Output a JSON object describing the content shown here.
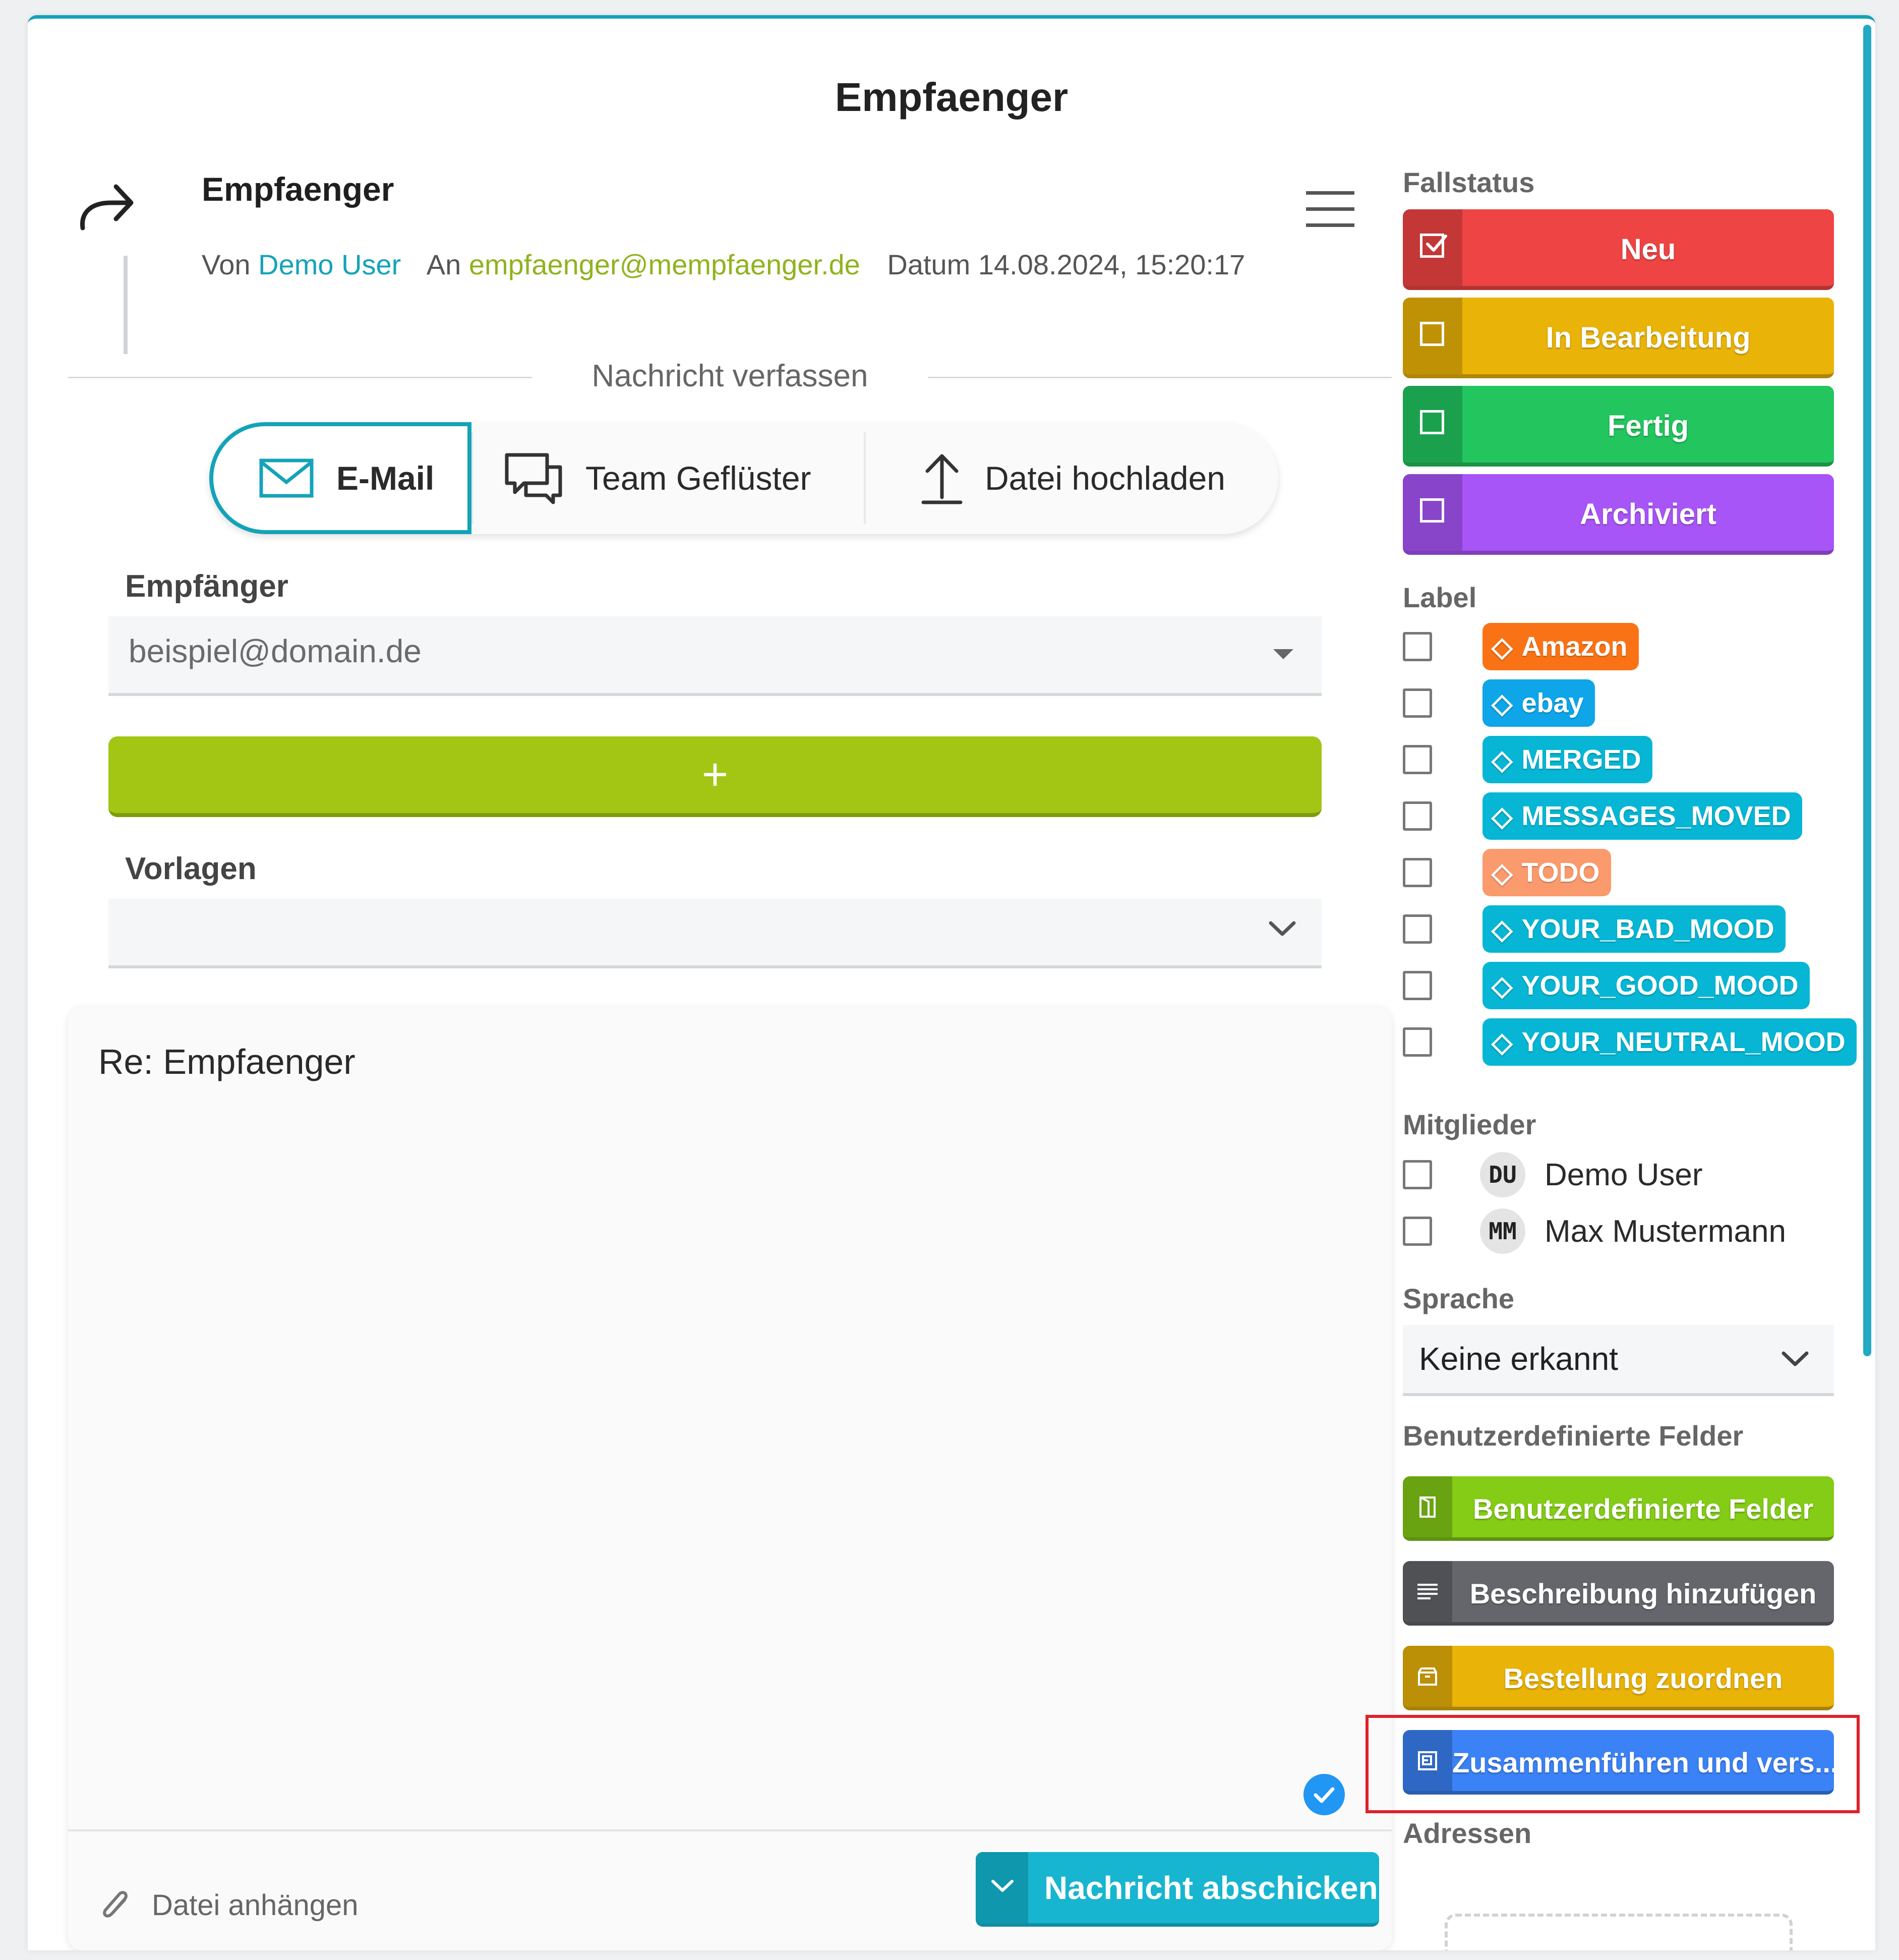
{
  "modal": {
    "title": "Empfaenger"
  },
  "message": {
    "subject": "Empfaenger",
    "from_label": "Von",
    "from_name": "Demo User",
    "to_label": "An",
    "to_address": "empfaenger@mempfaenger.de",
    "date_label": "Datum",
    "date_value": "14.08.2024, 15:20:17"
  },
  "compose": {
    "divider": "Nachricht verfassen",
    "tabs": [
      {
        "label": "E-Mail",
        "icon": "envelope-icon",
        "active": true
      },
      {
        "label": "Team Geflüster",
        "icon": "chat-bubbles-icon",
        "active": false
      },
      {
        "label": "Datei hochladen",
        "icon": "upload-icon",
        "active": false
      }
    ],
    "recipient_label": "Empfänger",
    "recipient_value": "beispiel@domain.de",
    "add_label": "+",
    "templates_label": "Vorlagen",
    "templates_value": "",
    "body_text": "Re: Empfaenger",
    "attach_label": "Datei anhängen",
    "send_label": "Nachricht abschicken"
  },
  "sidebar": {
    "status_heading": "Fallstatus",
    "statuses": [
      {
        "label": "Neu",
        "checked": true,
        "color": "#ef4444"
      },
      {
        "label": "In Bearbeitung",
        "checked": false,
        "color": "#eab308"
      },
      {
        "label": "Fertig",
        "checked": false,
        "color": "#22c55e"
      },
      {
        "label": "Archiviert",
        "checked": false,
        "color": "#a855f7"
      }
    ],
    "label_heading": "Label",
    "labels": [
      {
        "name": "Amazon",
        "color": "#f97316"
      },
      {
        "name": "ebay",
        "color": "#0ea5e9"
      },
      {
        "name": "MERGED",
        "color": "#06b6d4"
      },
      {
        "name": "MESSAGES_MOVED",
        "color": "#06b6d4"
      },
      {
        "name": "TODO",
        "color": "#fb9a6c"
      },
      {
        "name": "YOUR_BAD_MOOD",
        "color": "#06b6d4"
      },
      {
        "name": "YOUR_GOOD_MOOD",
        "color": "#06b6d4"
      },
      {
        "name": "YOUR_NEUTRAL_MOOD",
        "color": "#06b6d4"
      }
    ],
    "members_heading": "Mitglieder",
    "members": [
      {
        "initials": "DU",
        "name": "Demo User"
      },
      {
        "initials": "MM",
        "name": "Max Mustermann"
      }
    ],
    "language_heading": "Sprache",
    "language_value": "Keine erkannt",
    "custom_fields_heading": "Benutzerdefinierte Felder",
    "actions": [
      {
        "label": "Benutzerdefinierte Felder",
        "color": "#84cc16",
        "icon": "door-icon"
      },
      {
        "label": "Beschreibung hinzufügen",
        "color": "#64666b",
        "icon": "lines-icon"
      },
      {
        "label": "Bestellung zuordnen",
        "color": "#eab308",
        "icon": "box-icon"
      },
      {
        "label": "Zusammenführen und vers...",
        "color": "#3b82f6",
        "icon": "merge-icon"
      }
    ],
    "addresses_heading": "Adressen"
  }
}
